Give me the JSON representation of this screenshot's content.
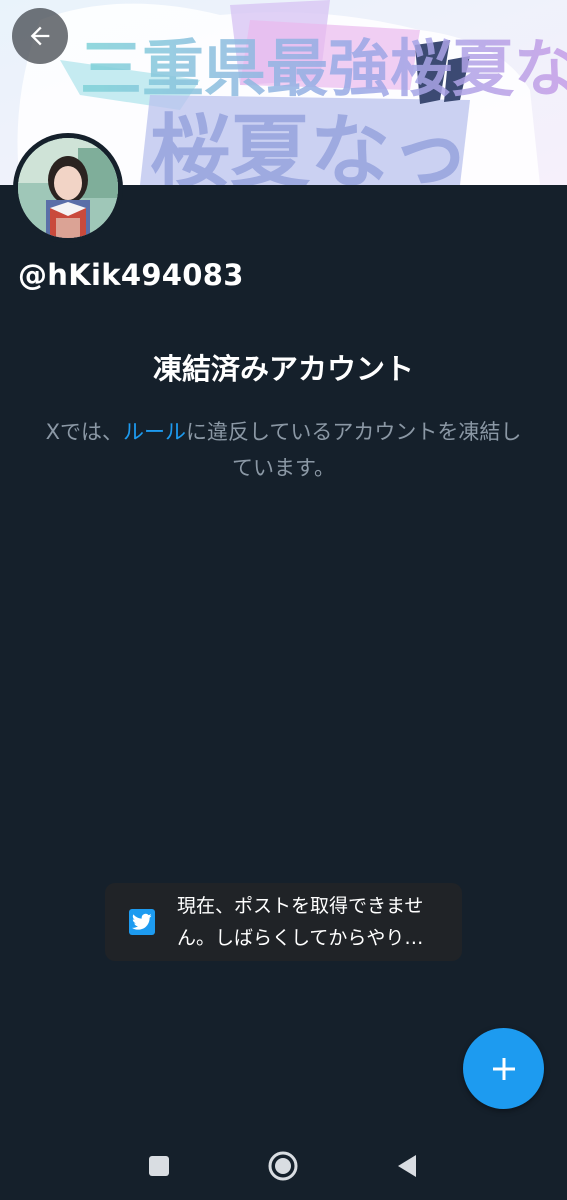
{
  "profile": {
    "handle": "@hKik494083"
  },
  "suspension": {
    "title": "凍結済みアカウント",
    "body_prefix": "Xでは、",
    "rules_link": "ルール",
    "body_suffix": "に違反しているアカウントを凍結しています。"
  },
  "toast": {
    "message": "現在、ポストを取得できません。しばらくしてからやり…",
    "icon": "twitter-bird-icon"
  },
  "fab": {
    "icon": "plus-icon"
  },
  "system_nav": {
    "recent_icon": "square-icon",
    "home_icon": "circle-icon",
    "back_icon": "triangle-back-icon"
  },
  "header": {
    "back_icon": "arrow-left-icon",
    "banner_text": "三重県最強桜夏なっ"
  },
  "colors": {
    "background": "#15202b",
    "accent": "#1d9bf0",
    "muted_text": "#8b98a5",
    "toast_bg": "#202327"
  }
}
